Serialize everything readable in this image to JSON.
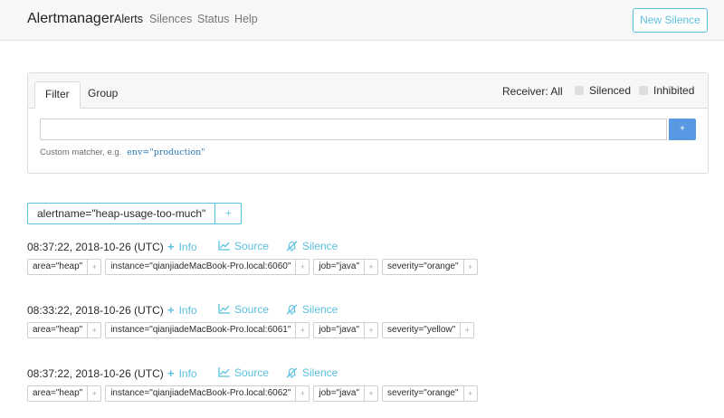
{
  "navbar": {
    "brand": "Alertmanager",
    "links": [
      {
        "label": "Alerts",
        "active": true
      },
      {
        "label": "Silences",
        "active": false
      },
      {
        "label": "Status",
        "active": false
      },
      {
        "label": "Help",
        "active": false
      }
    ],
    "new_silence_label": "New Silence"
  },
  "filter": {
    "tabs": [
      {
        "label": "Filter",
        "active": true
      },
      {
        "label": "Group",
        "active": false
      }
    ],
    "receiver_label": "Receiver: All",
    "silenced_label": "Silenced",
    "inhibited_label": "Inhibited",
    "input_value": "",
    "plus_label": "+",
    "hint_label": "Custom matcher, e.g.",
    "hint_example": "env=\"production\""
  },
  "group": {
    "label": "alertname=\"heap-usage-too-much\"",
    "plus_label": "+"
  },
  "actions": {
    "info_label": "Info",
    "source_label": "Source",
    "silence_label": "Silence"
  },
  "alerts": [
    {
      "time": "08:37:22, 2018-10-26 (UTC)",
      "labels": [
        "area=\"heap\"",
        "instance=\"qianjiadeMacBook-Pro.local:6060\"",
        "job=\"java\"",
        "severity=\"orange\""
      ]
    },
    {
      "time": "08:33:22, 2018-10-26 (UTC)",
      "labels": [
        "area=\"heap\"",
        "instance=\"qianjiadeMacBook-Pro.local:6061\"",
        "job=\"java\"",
        "severity=\"yellow\""
      ]
    },
    {
      "time": "08:37:22, 2018-10-26 (UTC)",
      "labels": [
        "area=\"heap\"",
        "instance=\"qianjiadeMacBook-Pro.local:6062\"",
        "job=\"java\"",
        "severity=\"orange\""
      ]
    }
  ],
  "colors": {
    "accent": "#5bc0de",
    "primary_button": "#5899e3",
    "navbar_bg": "#f7f7f7"
  }
}
